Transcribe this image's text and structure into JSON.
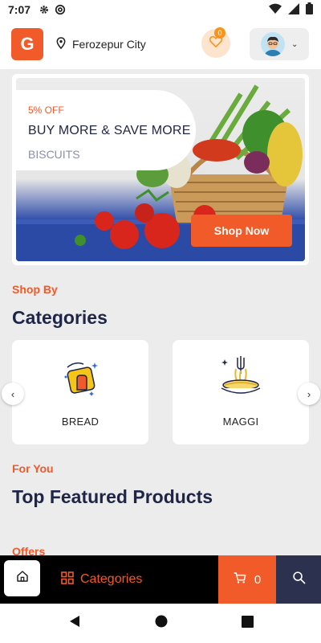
{
  "status_bar": {
    "time": "7:07"
  },
  "header": {
    "logo_letter": "G",
    "location": "Ferozepur City",
    "wishlist_count": "0"
  },
  "banner": {
    "discount": "5% OFF",
    "title": "BUY MORE & SAVE MORE",
    "subtitle": "BISCUITS",
    "button_label": "Shop Now"
  },
  "categories_section": {
    "kicker": "Shop By",
    "title": "Categories",
    "items": [
      {
        "label": "BREAD",
        "icon": "sponge-icon"
      },
      {
        "label": "MAGGI",
        "icon": "noodles-icon"
      }
    ]
  },
  "featured_section": {
    "kicker": "For You",
    "title": "Top Featured Products"
  },
  "offers_section": {
    "kicker": "Offers"
  },
  "bottom_bar": {
    "categories_label": "Categories",
    "cart_count": "0"
  },
  "colors": {
    "accent": "#f15a29",
    "navy": "#1f2547",
    "dark_tab": "#2d3150",
    "background": "#ececec"
  }
}
